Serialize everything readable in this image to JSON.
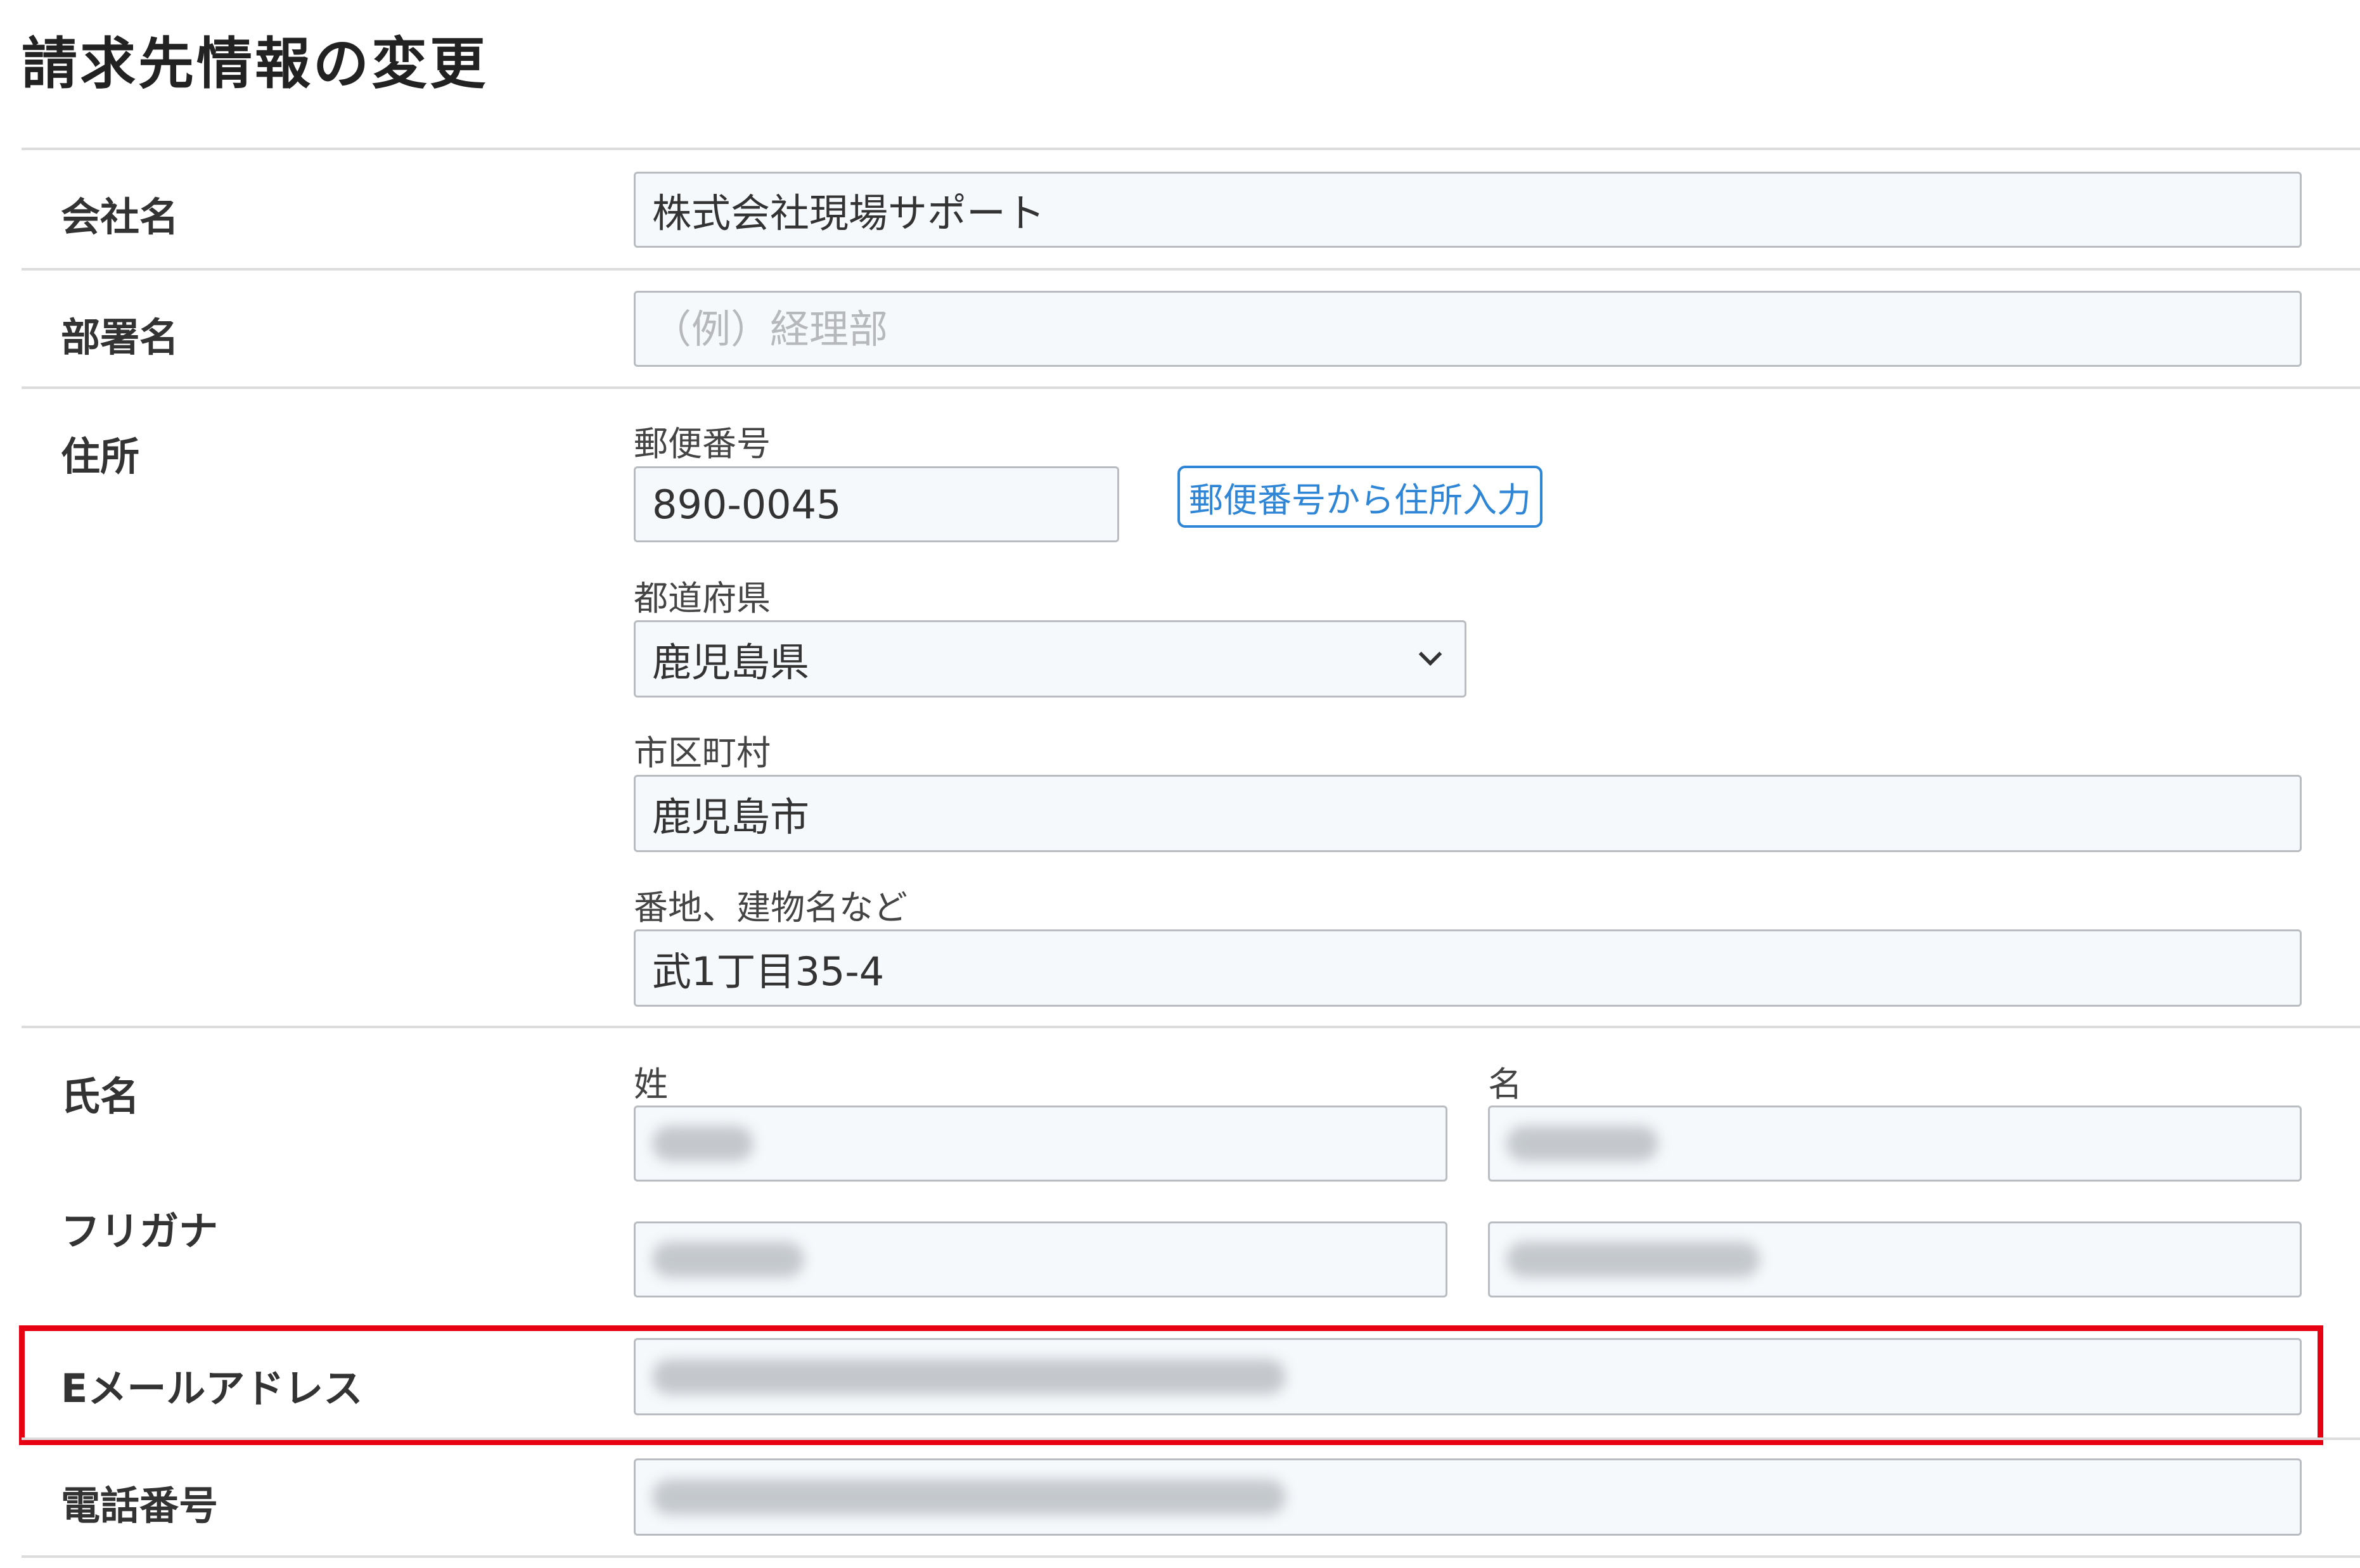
{
  "page": {
    "title": "請求先情報の変更"
  },
  "company": {
    "label": "会社名",
    "value": "株式会社現場サポート"
  },
  "department": {
    "label": "部署名",
    "placeholder": "（例）経理部"
  },
  "address": {
    "label": "住所",
    "postal_label": "郵便番号",
    "postal_value": "890-0045",
    "lookup_button": "郵便番号から住所入力",
    "prefecture_label": "都道府県",
    "prefecture_value": "鹿児島県",
    "city_label": "市区町村",
    "city_value": "鹿児島市",
    "street_label": "番地、建物名など",
    "street_value": "武1丁目35-4"
  },
  "name": {
    "label": "氏名",
    "last_label": "姓",
    "first_label": "名"
  },
  "furigana": {
    "label": "フリガナ"
  },
  "email": {
    "label": "Eメールアドレス",
    "highlight_color": "#e60012"
  },
  "phone": {
    "label": "電話番号"
  },
  "colors": {
    "accent": "#2f86d6",
    "field_bg": "#f6f9fc"
  },
  "icons": {
    "select": "chevron-down-icon"
  }
}
